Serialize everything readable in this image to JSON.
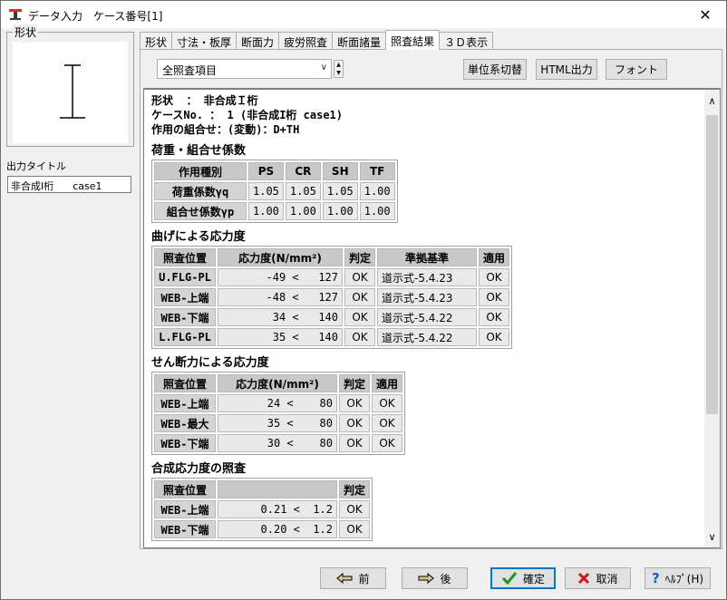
{
  "window": {
    "title": "データ入力　ケース番号[1]",
    "close_glyph": "✕"
  },
  "left": {
    "shape_label": "形状",
    "output_title_label": "出力タイトル",
    "output_title_value": "非合成I桁      case1"
  },
  "tabs": [
    "形状",
    "寸法・板厚",
    "断面力",
    "疲労照査",
    "断面諸量",
    "照査結果",
    "３Ｄ表示"
  ],
  "active_tab": "照査結果",
  "toolbar": {
    "combo_value": "全照査項目",
    "unit_button": "単位系切替",
    "html_button": "HTML出力",
    "font_button": "フォント"
  },
  "header": {
    "line1": "形状  ： 非合成Ｉ桁",
    "line2": "ケースNo. ： 1 (非合成I桁 case1)",
    "line3": "作用の組合せ：(変動)：D+TH"
  },
  "load_section": {
    "title": "荷重・組合せ係数",
    "headers": [
      "作用種別",
      "PS",
      "CR",
      "SH",
      "TF"
    ],
    "rows": [
      {
        "label": "荷重係数γq",
        "values": [
          "1.05",
          "1.05",
          "1.05",
          "1.00"
        ]
      },
      {
        "label": "組合せ係数γp",
        "values": [
          "1.00",
          "1.00",
          "1.00",
          "1.00"
        ]
      }
    ]
  },
  "bending_section": {
    "title": "曲げによる応力度",
    "headers": [
      "照査位置",
      "応力度(N/mm²)",
      "判定",
      "準拠基準",
      "適用"
    ],
    "rows": [
      {
        "pos": "U.FLG-PL",
        "stress": "-49 <   127",
        "judge": "OK",
        "basis": "道示式-5.4.23",
        "apply": "OK"
      },
      {
        "pos": "WEB-上端",
        "stress": "-48 <   127",
        "judge": "OK",
        "basis": "道示式-5.4.23",
        "apply": "OK"
      },
      {
        "pos": "WEB-下端",
        "stress": "34 <   140",
        "judge": "OK",
        "basis": "道示式-5.4.22",
        "apply": "OK"
      },
      {
        "pos": "L.FLG-PL",
        "stress": "35 <   140",
        "judge": "OK",
        "basis": "道示式-5.4.22",
        "apply": "OK"
      }
    ]
  },
  "shear_section": {
    "title": "せん断力による応力度",
    "headers": [
      "照査位置",
      "応力度(N/mm²)",
      "判定",
      "適用"
    ],
    "rows": [
      {
        "pos": "WEB-上端",
        "stress": "24 <    80",
        "judge": "OK",
        "apply": "OK"
      },
      {
        "pos": "WEB-最大",
        "stress": "35 <    80",
        "judge": "OK",
        "apply": "OK"
      },
      {
        "pos": "WEB-下端",
        "stress": "30 <    80",
        "judge": "OK",
        "apply": "OK"
      }
    ]
  },
  "combined_section": {
    "title": "合成応力度の照査",
    "headers": [
      "照査位置",
      "",
      "判定"
    ],
    "rows": [
      {
        "pos": "WEB-上端",
        "value": "0.21 <  1.2",
        "judge": "OK"
      },
      {
        "pos": "WEB-下端",
        "value": "0.20 <  1.2",
        "judge": "OK"
      }
    ]
  },
  "buttons": {
    "prev": "前",
    "next": "後",
    "ok": "確定",
    "cancel": "取消",
    "help": "ﾍﾙﾌﾟ(H)"
  }
}
